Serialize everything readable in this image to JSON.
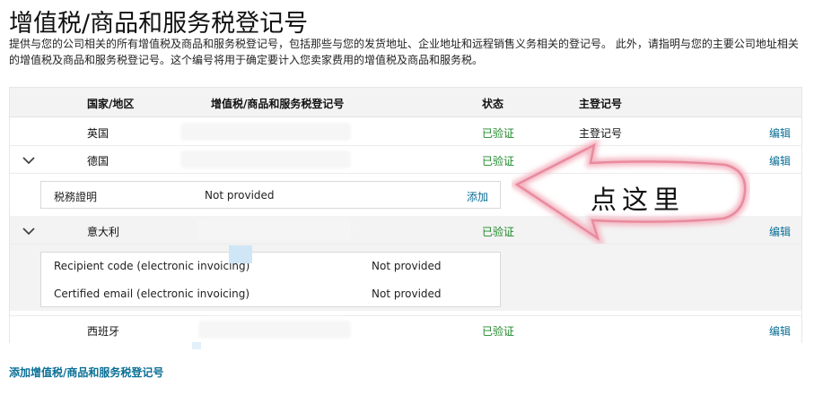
{
  "page": {
    "title": "增值税/商品和服务税登记号",
    "description": "提供与您的公司相关的所有增值税及商品和服务税登记号，包括那些与您的发货地址、企业地址和远程销售义务相关的登记号。 此外，请指明与您的主要公司地址相关的增值税及商品和服务税登记号。这个编号将用于确定要计入您卖家费用的增值税及商品和服务税。"
  },
  "table": {
    "headers": {
      "country": "国家/地区",
      "vat": "增值税/商品和服务税登记号",
      "status": "状态",
      "primary": "主登记号"
    },
    "rows": [
      {
        "country": "英国",
        "status": "已验证",
        "primary": "主登记号",
        "action": "编辑"
      },
      {
        "country": "德国",
        "status": "已验证",
        "action": "编辑",
        "sub": [
          {
            "label": "税務證明",
            "value": "Not provided",
            "action": "添加"
          }
        ]
      },
      {
        "country": "意大利",
        "status": "已验证",
        "action": "编辑",
        "sub": [
          {
            "label": "Recipient code (electronic invoicing)",
            "value": "Not provided"
          },
          {
            "label": "Certified email (electronic invoicing)",
            "value": "Not provided"
          }
        ]
      },
      {
        "country": "西班牙",
        "status": "已验证",
        "action": "编辑"
      }
    ]
  },
  "add_link": "添加增值税/商品和服务税登记号",
  "annotation": {
    "text": "点这里",
    "color": "#e98b9e"
  },
  "colors": {
    "verified": "#1f8a2a",
    "link": "#0a6f96",
    "header_bg": "#f3f3f3"
  }
}
